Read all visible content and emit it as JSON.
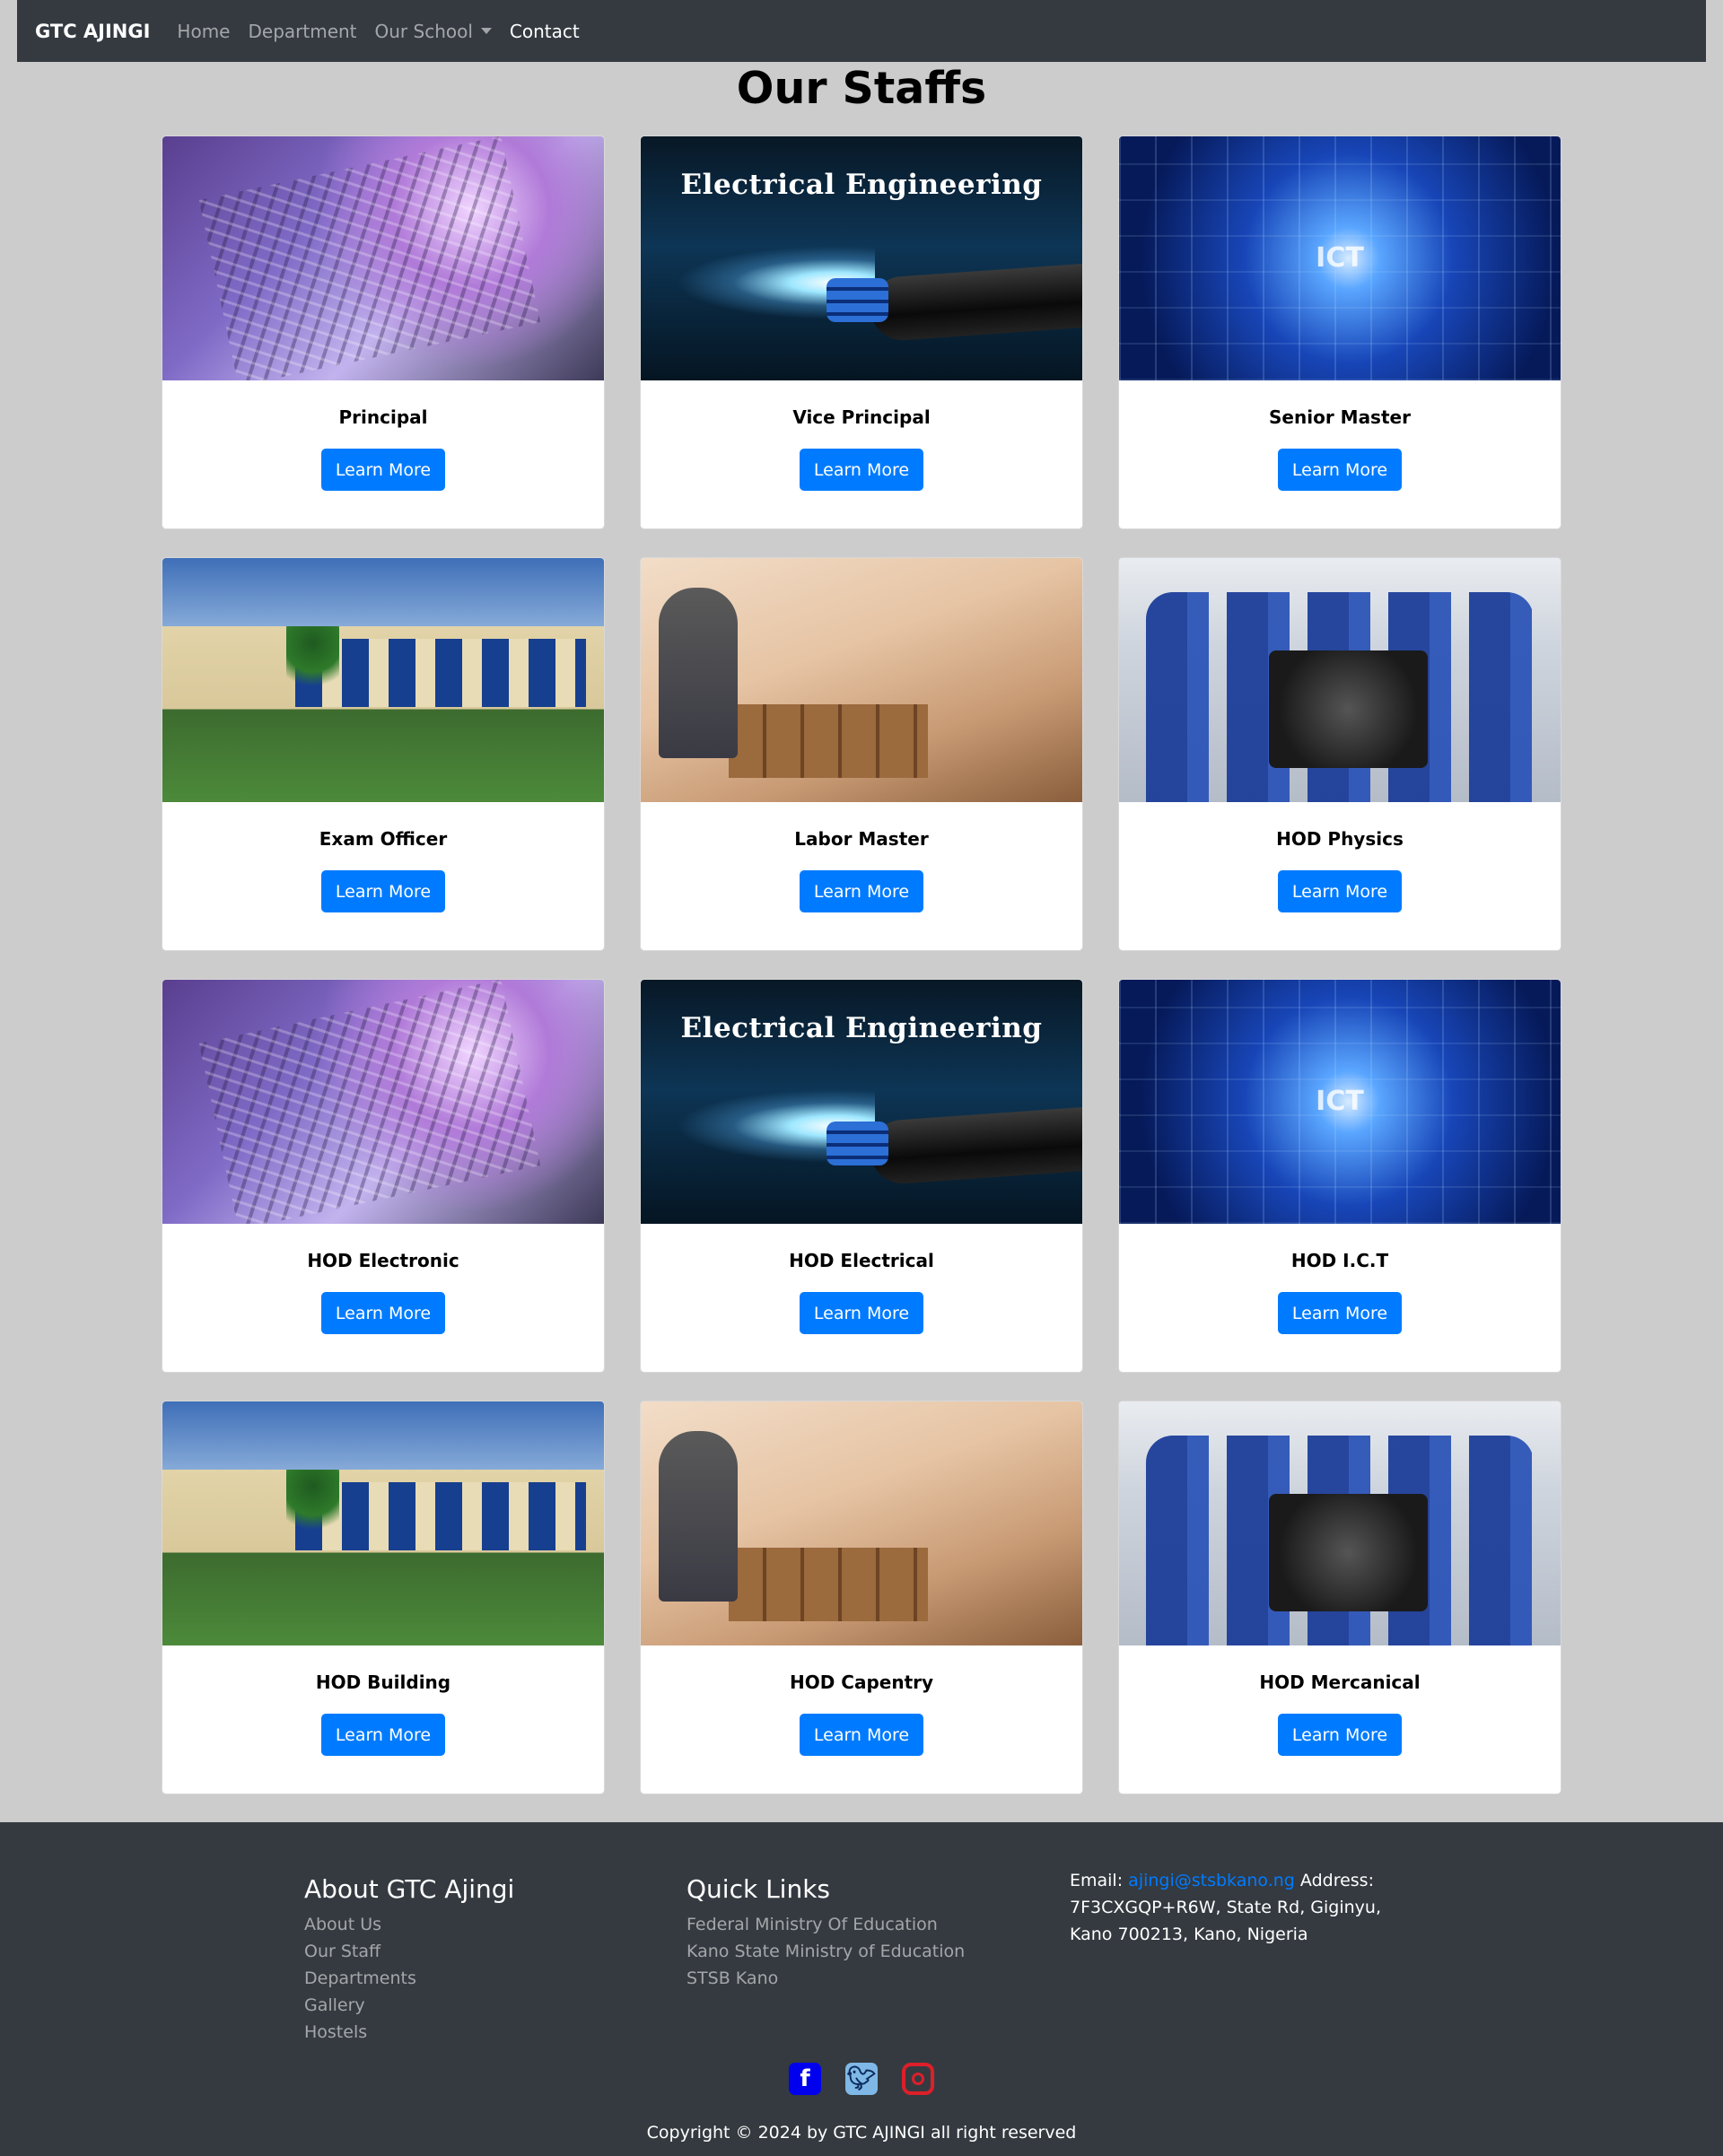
{
  "navbar": {
    "brand": "GTC AJINGI",
    "links": [
      "Home",
      "Department",
      "Our School",
      "Contact"
    ]
  },
  "page_title": "Our Staffs",
  "image_texts": {
    "electrical": "Electrical Engineering",
    "ict": "ICT"
  },
  "cards": [
    {
      "title": "Principal",
      "button": "Learn More"
    },
    {
      "title": "Vice Principal",
      "button": "Learn More"
    },
    {
      "title": "Senior Master",
      "button": "Learn More"
    },
    {
      "title": "Exam Officer",
      "button": "Learn More"
    },
    {
      "title": "Labor Master",
      "button": "Learn More"
    },
    {
      "title": "HOD Physics",
      "button": "Learn More"
    },
    {
      "title": "HOD Electronic",
      "button": "Learn More"
    },
    {
      "title": "HOD Electrical",
      "button": "Learn More"
    },
    {
      "title": "HOD I.C.T",
      "button": "Learn More"
    },
    {
      "title": "HOD Building",
      "button": "Learn More"
    },
    {
      "title": "HOD Capentry",
      "button": "Learn More"
    },
    {
      "title": "HOD Mercanical",
      "button": "Learn More"
    }
  ],
  "footer": {
    "about_heading": "About GTC Ajingi",
    "about_links": [
      "About Us",
      "Our Staff",
      "Departments",
      "Gallery",
      "Hostels"
    ],
    "quick_heading": "Quick Links",
    "quick_links": [
      "Federal Ministry Of Education",
      "Kano State Ministry of Education",
      "STSB Kano"
    ],
    "email_label": "Email:",
    "email": "ajingi@stsbkano.ng",
    "address_label": "Address:",
    "address": "7F3CXGQP+R6W, State Rd, Giginyu, Kano 700213, Kano, Nigeria",
    "social": [
      "facebook-icon",
      "twitter-icon",
      "instagram-icon"
    ],
    "copyright": "Copyright © 2024 by GTC AJINGI all right reserved"
  },
  "colors": {
    "navbar_bg": "#343a40",
    "page_bg": "#cccccc",
    "button_bg": "#007bff",
    "footer_bg": "#343a40"
  }
}
